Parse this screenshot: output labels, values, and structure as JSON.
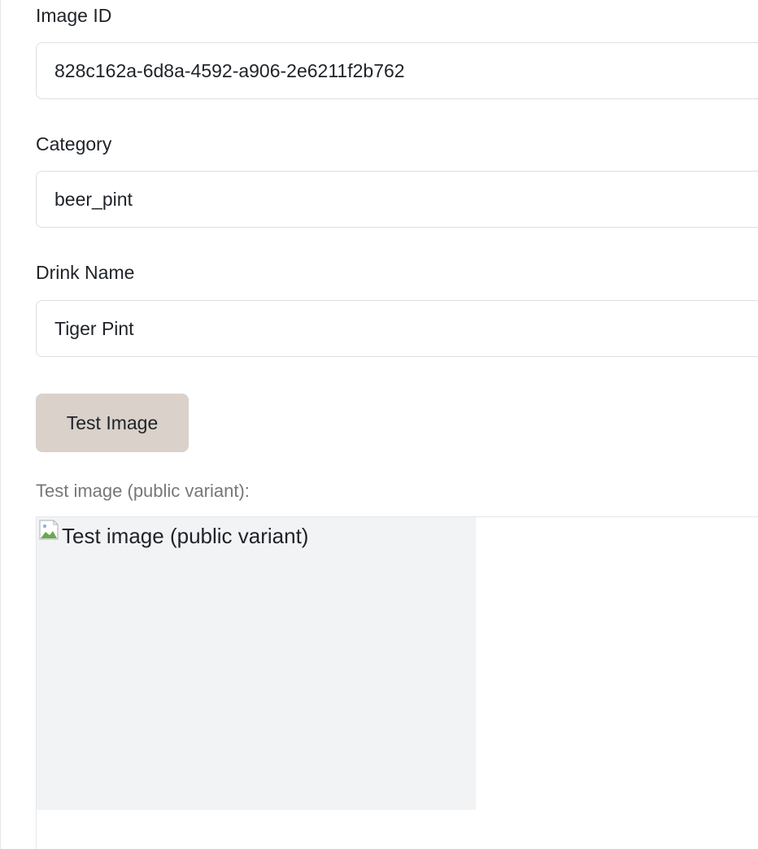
{
  "form": {
    "image_id": {
      "label": "Image ID",
      "value": "828c162a-6d8a-4592-a906-2e6211f2b762"
    },
    "category": {
      "label": "Category",
      "value": "beer_pint"
    },
    "drink_name": {
      "label": "Drink Name",
      "value": "Tiger Pint"
    },
    "test_button_label": "Test Image"
  },
  "preview": {
    "label": "Test image (public variant):",
    "image_alt": "Test image (public variant)",
    "broken_image_icon": "broken-image-icon"
  },
  "colors": {
    "button_bg": "#d9d1ca",
    "preview_bg": "#f2f3f5",
    "muted_text": "#777777"
  }
}
